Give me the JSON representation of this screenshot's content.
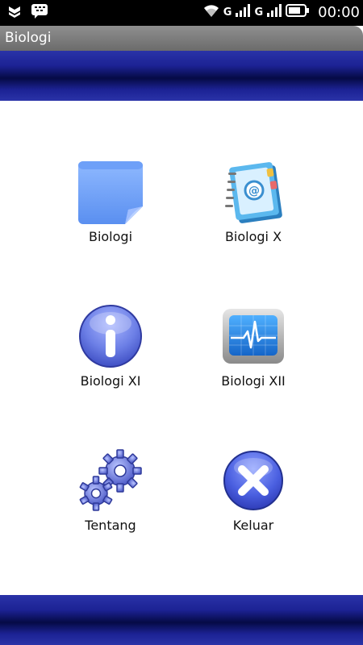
{
  "status_bar": {
    "time": "00:00",
    "signal_label_1": "G",
    "signal_label_2": "G",
    "icons": [
      "shield-icon",
      "bbm-chat-icon",
      "wifi-icon",
      "signal-icon",
      "signal-icon",
      "battery-icon"
    ]
  },
  "app": {
    "title": "Biologi"
  },
  "colors": {
    "banner_dark": "#050a45",
    "banner_light": "#2a33a8",
    "title_bar": "#7a7a7a"
  },
  "menu": [
    {
      "label": "Biologi",
      "icon": "sticky-note-icon"
    },
    {
      "label": "Biologi X",
      "icon": "address-book-icon"
    },
    {
      "label": "Biologi XI",
      "icon": "info-icon"
    },
    {
      "label": "Biologi XII",
      "icon": "heart-monitor-icon"
    },
    {
      "label": "Tentang",
      "icon": "gears-icon"
    },
    {
      "label": "Keluar",
      "icon": "close-icon"
    }
  ]
}
